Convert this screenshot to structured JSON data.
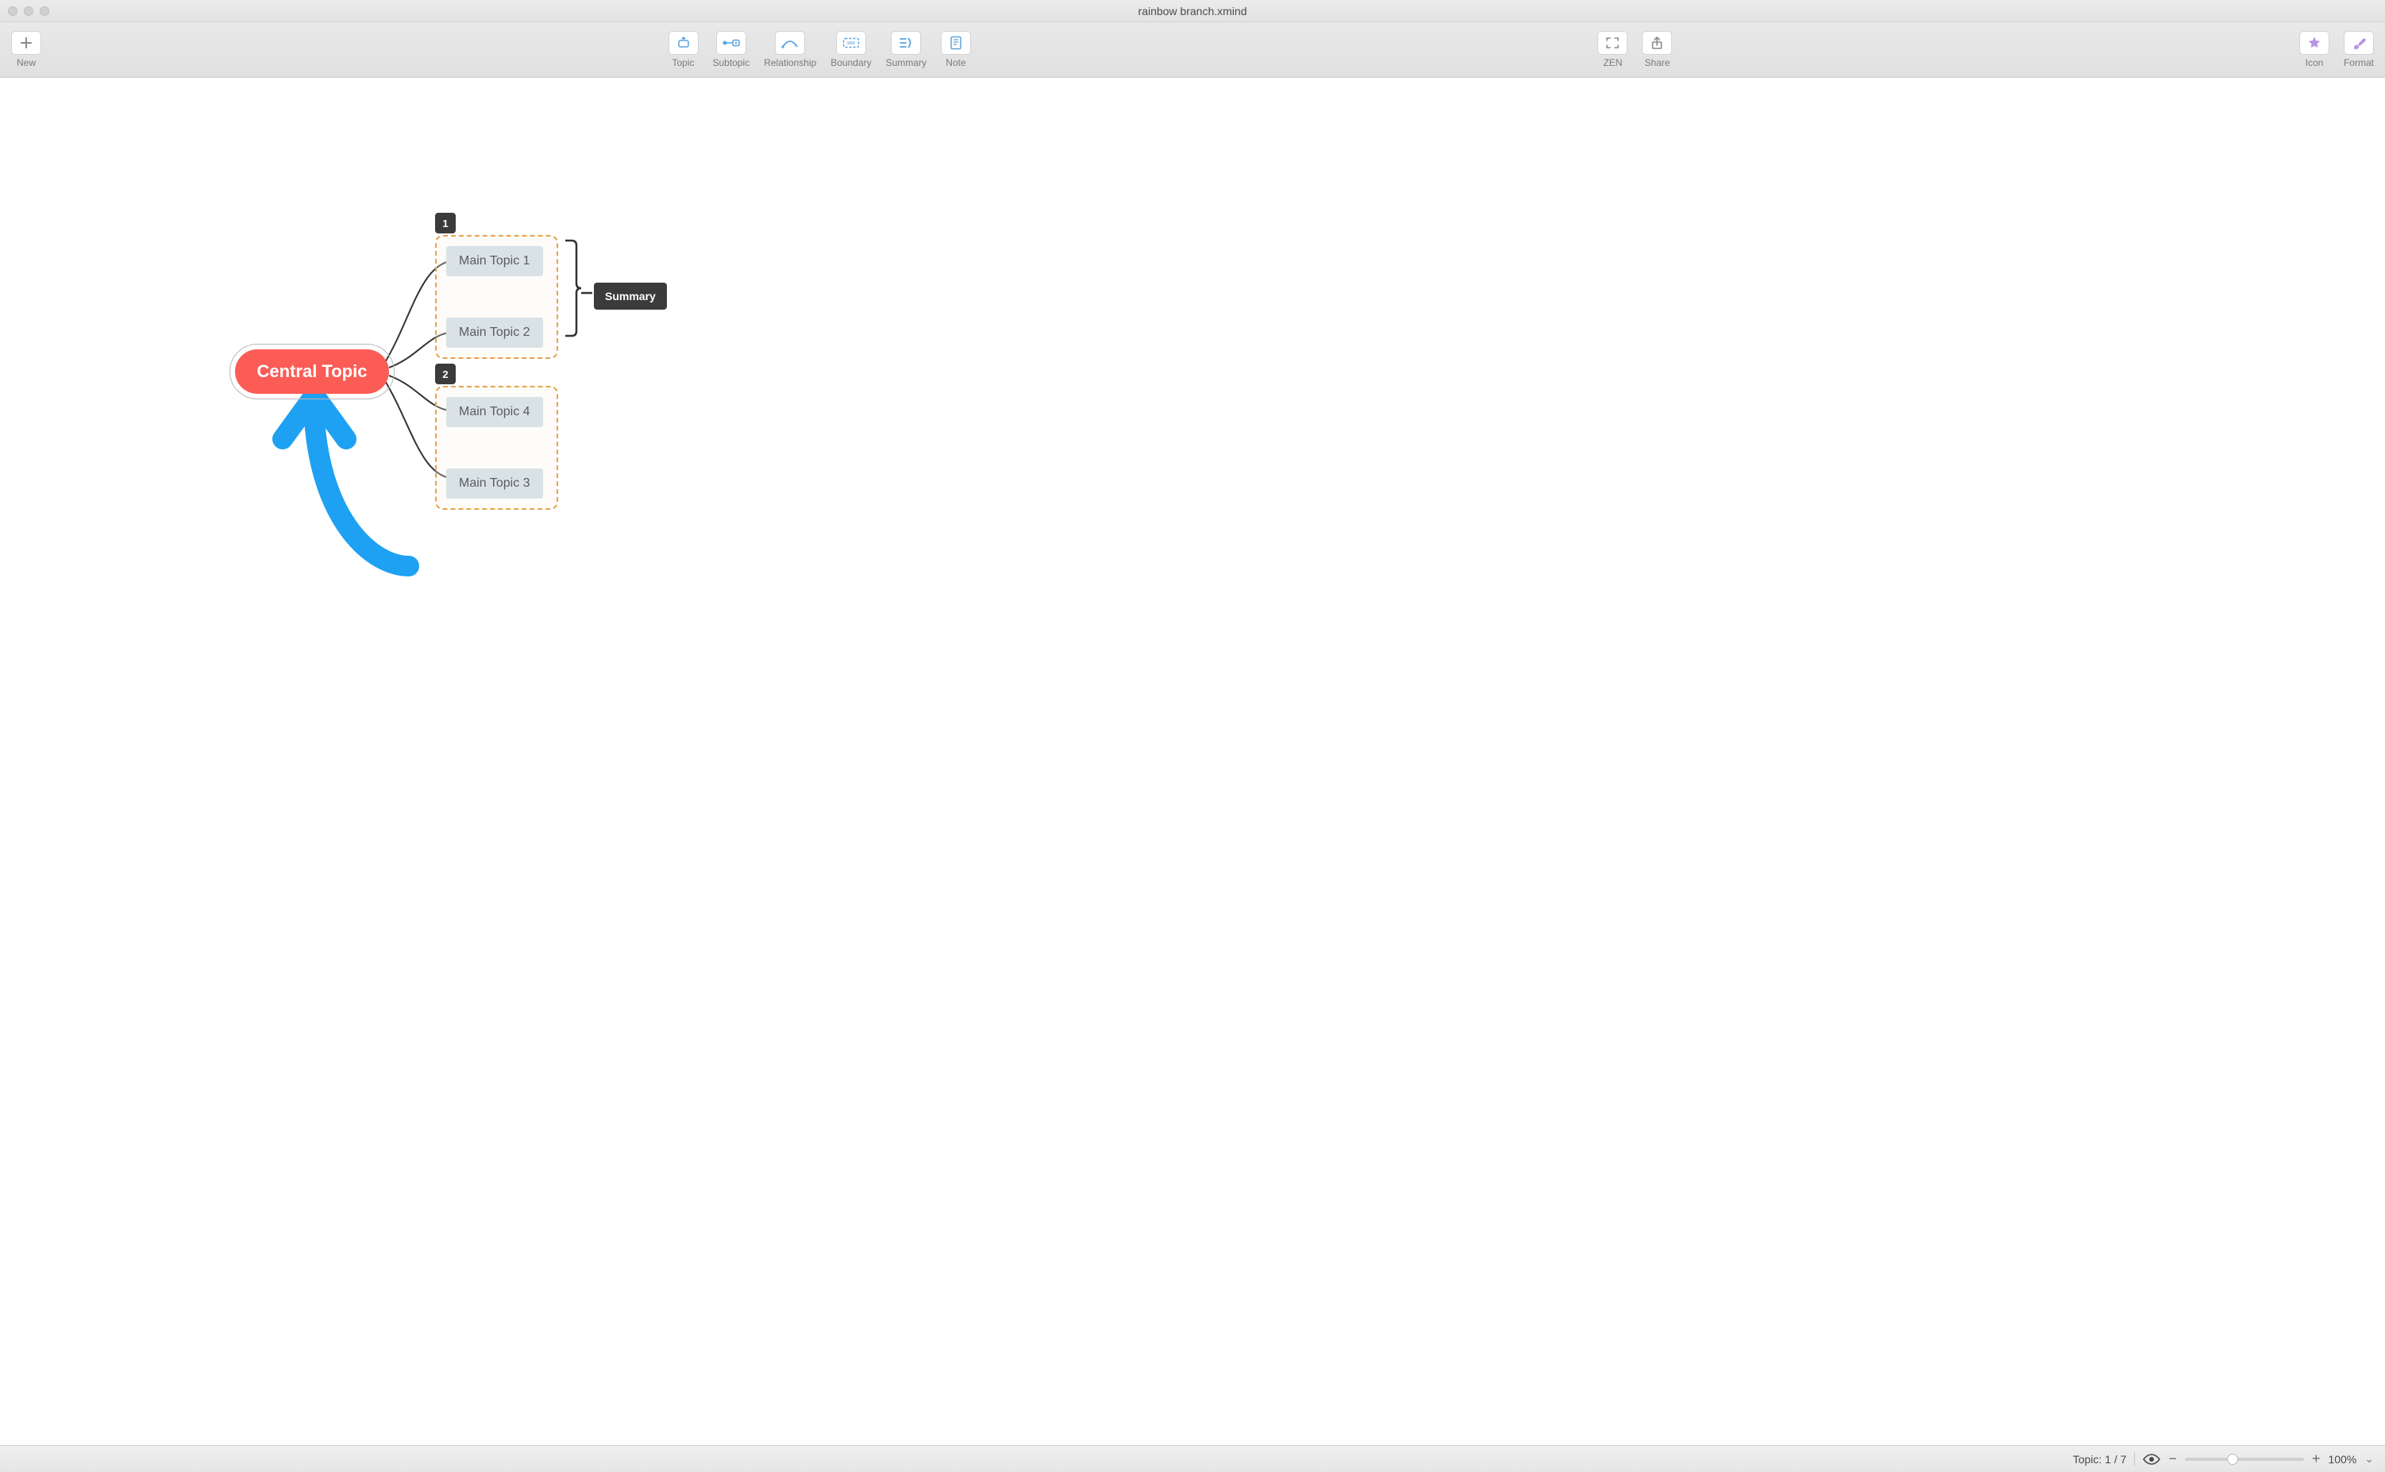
{
  "window": {
    "title": "rainbow branch.xmind"
  },
  "toolbar": {
    "left": [
      {
        "id": "new",
        "label": "New",
        "icon": "plus"
      }
    ],
    "center": [
      {
        "id": "topic",
        "label": "Topic",
        "icon": "topic"
      },
      {
        "id": "subtopic",
        "label": "Subtopic",
        "icon": "subtopic"
      },
      {
        "id": "relationship",
        "label": "Relationship",
        "icon": "relationship"
      },
      {
        "id": "boundary",
        "label": "Boundary",
        "icon": "boundary"
      },
      {
        "id": "summary",
        "label": "Summary",
        "icon": "summary"
      },
      {
        "id": "note",
        "label": "Note",
        "icon": "note"
      }
    ],
    "mid": [
      {
        "id": "zen",
        "label": "ZEN",
        "icon": "zen"
      },
      {
        "id": "share",
        "label": "Share",
        "icon": "share"
      }
    ],
    "right": [
      {
        "id": "icon",
        "label": "Icon",
        "icon": "star"
      },
      {
        "id": "format",
        "label": "Format",
        "icon": "brush"
      }
    ]
  },
  "mindmap": {
    "central": {
      "label": "Central Topic"
    },
    "boundaries": [
      {
        "badge": "1",
        "topics": [
          "Main Topic 1",
          "Main Topic 2"
        ]
      },
      {
        "badge": "2",
        "topics": [
          "Main Topic 4",
          "Main Topic 3"
        ]
      }
    ],
    "summary": {
      "label": "Summary"
    },
    "annotation_arrow": {
      "color": "#1ea1f2"
    }
  },
  "status": {
    "topic_label": "Topic:",
    "topic_index": "1",
    "topic_sep": "/",
    "topic_total": "7",
    "zoom_percent": "100%",
    "zoom_thumb_pct": 40
  }
}
